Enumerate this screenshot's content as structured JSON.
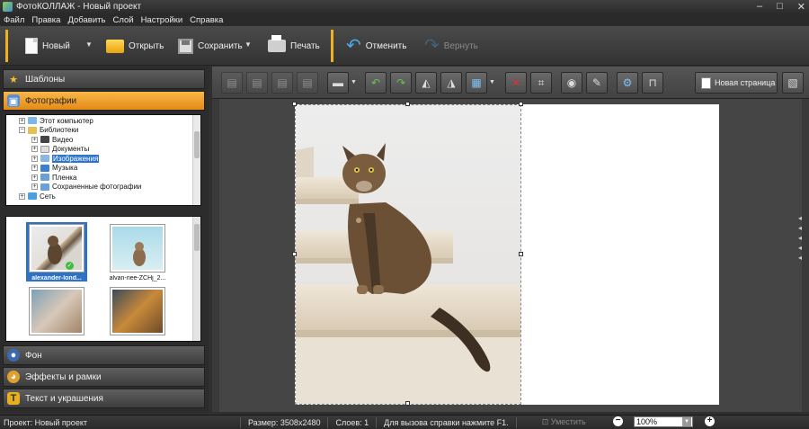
{
  "window": {
    "title": "ФотоКОЛЛАЖ - Новый проект"
  },
  "menu": [
    "Файл",
    "Правка",
    "Добавить",
    "Слой",
    "Настройки",
    "Справка"
  ],
  "toolbar": {
    "new_label": "Новый",
    "open_label": "Открыть",
    "save_label": "Сохранить",
    "print_label": "Печать",
    "undo_label": "Отменить",
    "redo_label": "Вернуть"
  },
  "panels": {
    "templates": "Шаблоны",
    "photos": "Фотографии",
    "background": "Фон",
    "effects": "Эффекты и рамки",
    "text": "Текст и украшения"
  },
  "tree": [
    {
      "label": "Этот компьютер"
    },
    {
      "label": "Библиотеки"
    },
    {
      "label": "Видео"
    },
    {
      "label": "Документы"
    },
    {
      "label": "Изображения"
    },
    {
      "label": "Музыка"
    },
    {
      "label": "Пленка"
    },
    {
      "label": "Сохраненные фотографии"
    },
    {
      "label": "Сеть"
    }
  ],
  "thumbnails": [
    {
      "name": "alexander-lond..."
    },
    {
      "name": "alvan-nee-ZCHj_2..."
    }
  ],
  "workspace": {
    "new_page_label": "Новая страница"
  },
  "status": {
    "project": "Проект:  Новый проект",
    "size": "Размер:  3508x2480",
    "layers": "Слоев:  1",
    "help": "Для вызова справки нажмите F1.",
    "fit_label": "Уместить",
    "zoom": "100%"
  },
  "colors": {
    "accent_orange": "#f0a020",
    "selection_blue": "#2d72c6"
  }
}
